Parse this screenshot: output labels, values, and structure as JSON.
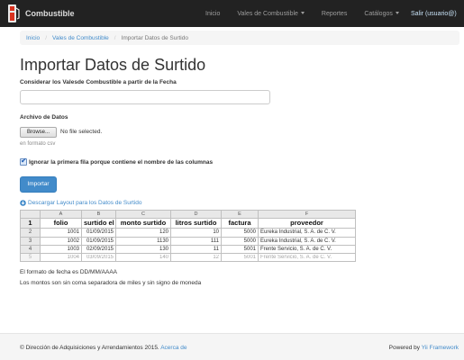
{
  "navbar": {
    "brand": "Combustible",
    "items": [
      {
        "label": "Inicio"
      },
      {
        "label": "Vales de Combustible",
        "dropdown": true
      },
      {
        "label": "Reportes"
      },
      {
        "label": "Catálogos",
        "dropdown": true
      }
    ],
    "logout": "Salir (usuario@)",
    "bg_color": "#222222"
  },
  "breadcrumb": {
    "items": [
      "Inicio",
      "Vales de Combustible"
    ],
    "active": "Importar Datos de Surtido"
  },
  "page_title": "Importar Datos de Surtido",
  "form": {
    "date_label": "Considerar los Valesde Combustible a partir de la Fecha",
    "date_value": "",
    "file_label": "Archivo de Datos",
    "browse_label": "Browse...",
    "no_file_text": "No file selected.",
    "file_help": "en formato csv",
    "checkbox_checked": true,
    "checkbox_label": "Ignorar la primera fila porque contiene el nombre de las columnas",
    "submit_label": "Importar",
    "accent_color": "#428bca"
  },
  "download_link": "Descargar Layout para los Datos de Surtido",
  "sheet": {
    "columns": [
      "A",
      "B",
      "C",
      "D",
      "E",
      "F"
    ],
    "header_row_number": "1",
    "headers": [
      "folio",
      "surtido el",
      "monto surtido",
      "litros surtido",
      "factura",
      "proveedor"
    ],
    "rows": [
      {
        "n": "2",
        "cells": [
          "1001",
          "01/09/2015",
          "120",
          "10",
          "5000",
          "Eureka Industrial, S. A. de C. V."
        ]
      },
      {
        "n": "3",
        "cells": [
          "1002",
          "01/09/2015",
          "1130",
          "111",
          "5000",
          "Eureka Industrial, S. A. de C. V."
        ]
      },
      {
        "n": "4",
        "cells": [
          "1003",
          "02/09/2015",
          "130",
          "11",
          "5001",
          "Frente Servicio, S. A. de C. V."
        ]
      },
      {
        "n": "5",
        "cells": [
          "1004",
          "03/09/2015",
          "140",
          "12",
          "5001",
          "Frente Servicio, S. A. de C. V."
        ]
      }
    ]
  },
  "notes": [
    "El formato de fecha es DD/MM/AAAA",
    "Los montos son sin coma separadora de miles y sin signo de moneda"
  ],
  "footer": {
    "left_text": "© Dirección de Adquisiciones y Arrendamientos 2015.",
    "left_link": "Acerca de",
    "right_text": "Powered by",
    "right_link": "Yii Framework"
  }
}
